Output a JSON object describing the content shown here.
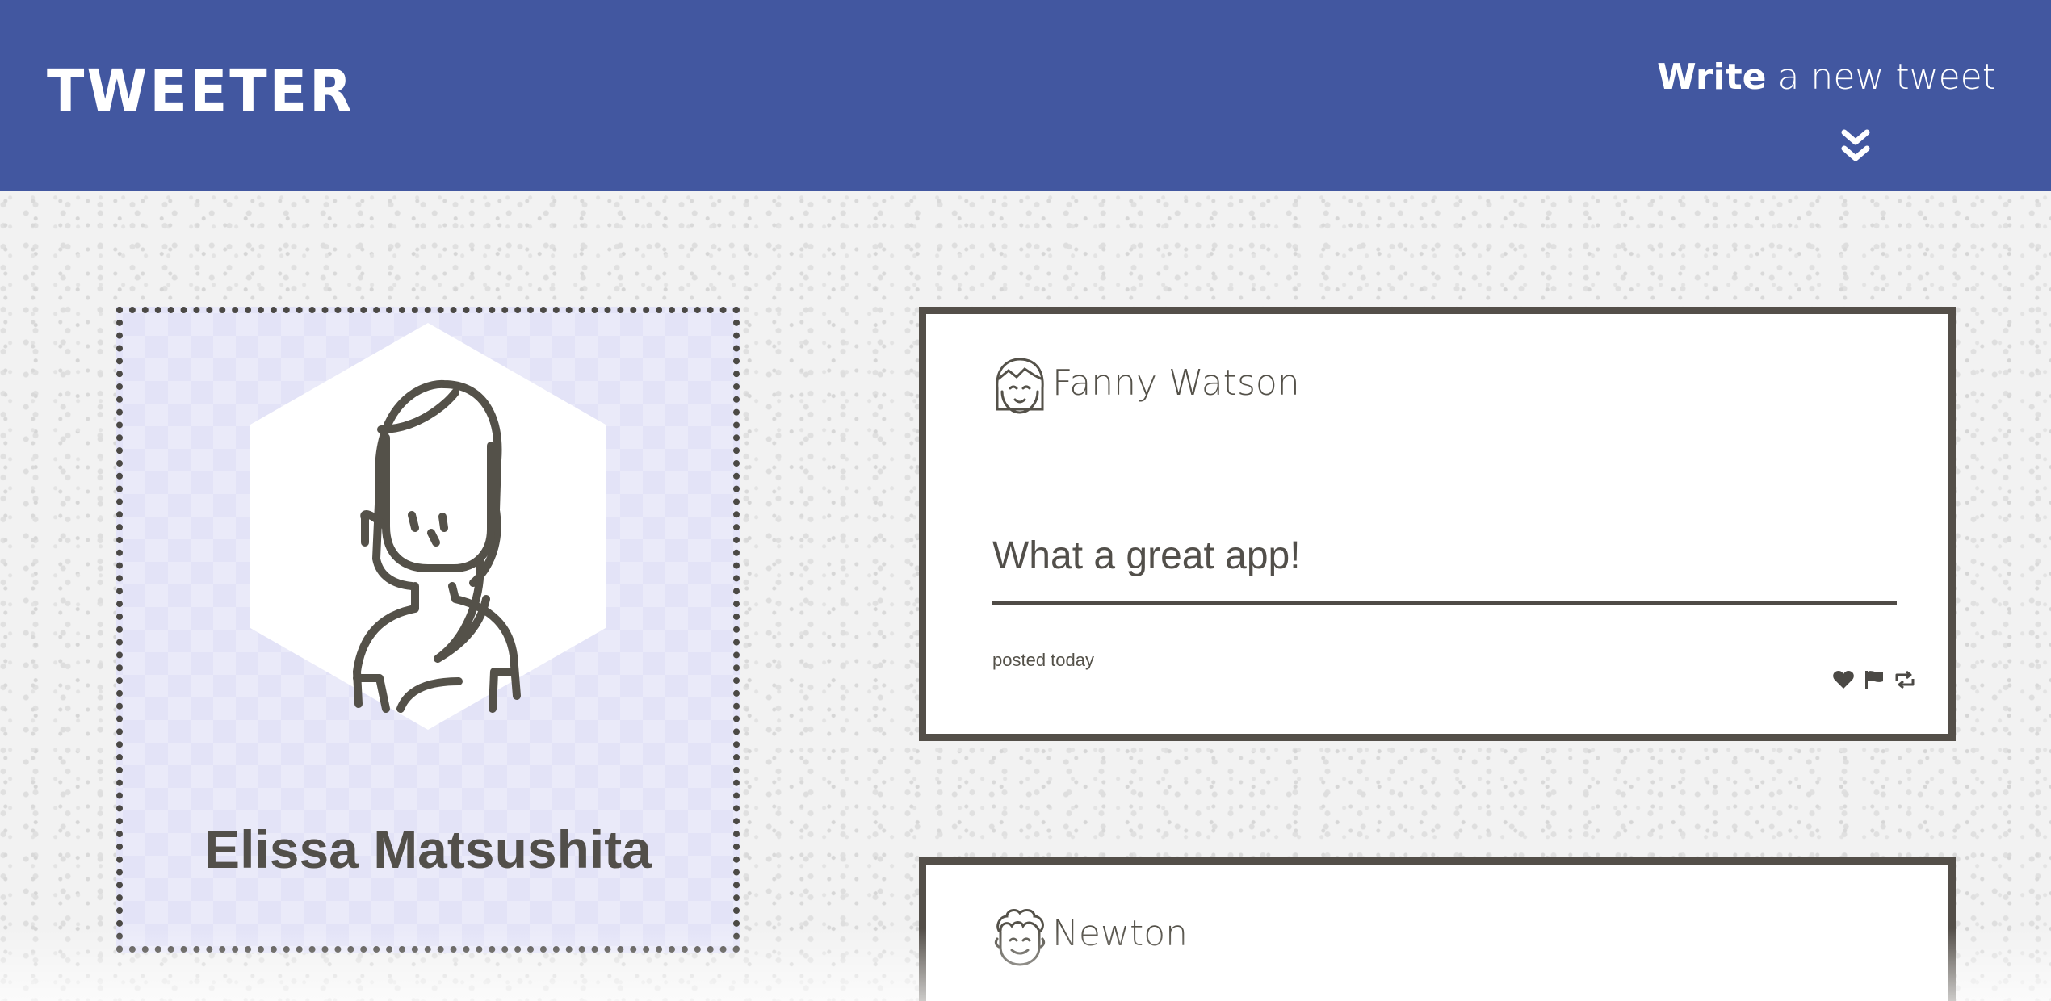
{
  "nav": {
    "brand": "TWEETER",
    "compose_strong": "Write",
    "compose_rest": " a new tweet"
  },
  "profile": {
    "name": "Elissa Matsushita",
    "avatar": "woman-long-hair-avatar"
  },
  "tweets": [
    {
      "author": "Fanny Watson",
      "avatar": "girl-bangs-avatar",
      "body": "What a great app!",
      "time": "posted today",
      "actions": [
        "heart-icon",
        "flag-icon",
        "retweet-icon"
      ]
    },
    {
      "author": "Newton",
      "avatar": "curly-hair-man-avatar"
    }
  ],
  "colors": {
    "nav_bg": "#4257a0",
    "text": "#545149",
    "profile_bg": "#e3e3f7"
  }
}
